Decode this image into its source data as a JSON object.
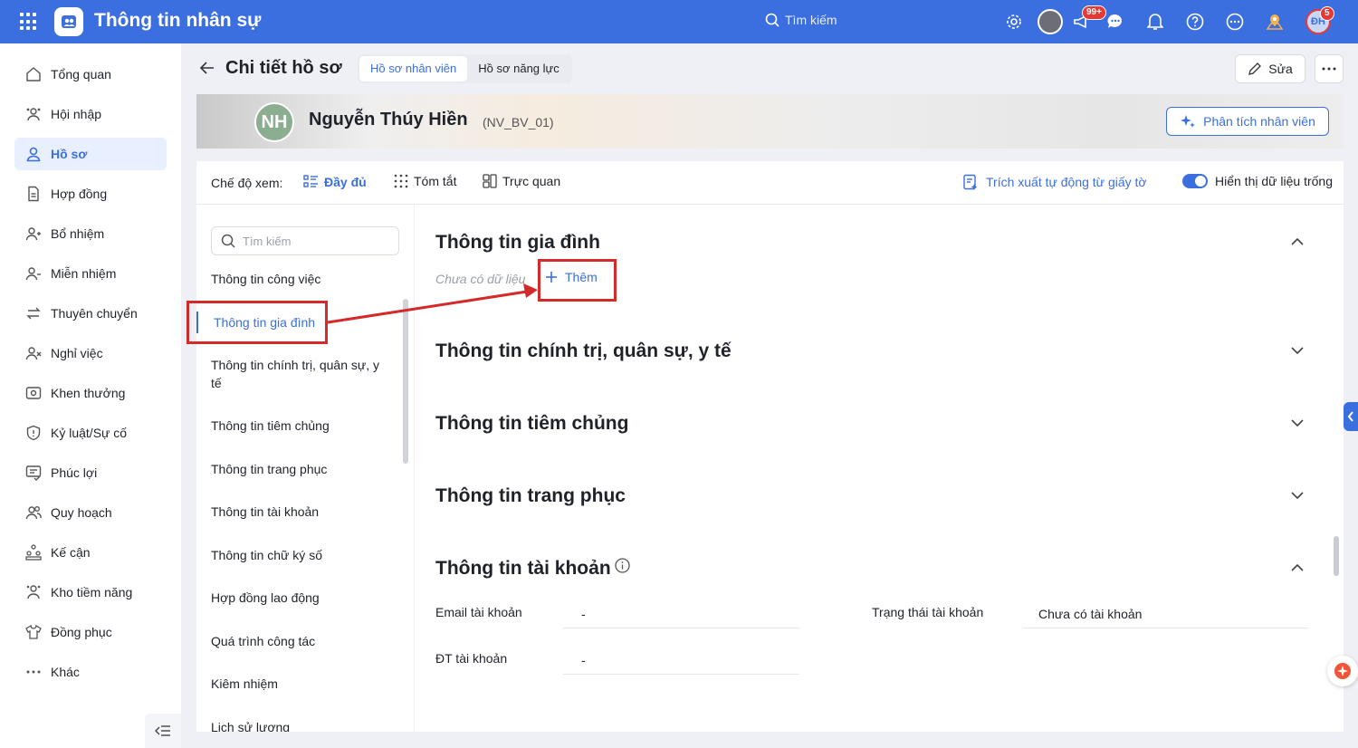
{
  "app": {
    "title": "Thông tin nhân sự",
    "search_placeholder": "Tìm kiếm"
  },
  "topbar": {
    "badges": {
      "notifications": "99+",
      "avatar": "5"
    },
    "user_initials": "ĐH",
    "icons": [
      "gear-icon",
      "avatar",
      "megaphone-icon",
      "chat-icon",
      "bell-icon",
      "help-icon",
      "more-circle-icon",
      "location-icon",
      "user-avatar"
    ]
  },
  "sidebar": {
    "items": [
      {
        "label": "Tổng quan",
        "icon": "home-icon"
      },
      {
        "label": "Hội nhập",
        "icon": "users-icon"
      },
      {
        "label": "Hồ sơ",
        "icon": "user-icon",
        "active": true
      },
      {
        "label": "Hợp đồng",
        "icon": "document-icon"
      },
      {
        "label": "Bổ nhiệm",
        "icon": "user-plus-icon"
      },
      {
        "label": "Miễn nhiệm",
        "icon": "user-minus-icon"
      },
      {
        "label": "Thuyên chuyển",
        "icon": "transfer-icon"
      },
      {
        "label": "Nghỉ việc",
        "icon": "user-x-icon"
      },
      {
        "label": "Khen thưởng",
        "icon": "reward-icon"
      },
      {
        "label": "Kỷ luật/Sự cố",
        "icon": "shield-icon"
      },
      {
        "label": "Phúc lợi",
        "icon": "benefit-icon"
      },
      {
        "label": "Quy hoạch",
        "icon": "group-icon"
      },
      {
        "label": "Kế cận",
        "icon": "org-icon"
      },
      {
        "label": "Kho tiềm năng",
        "icon": "talent-icon"
      },
      {
        "label": "Đồng phục",
        "icon": "shirt-icon"
      },
      {
        "label": "Khác",
        "icon": "dots-icon"
      }
    ]
  },
  "header": {
    "title": "Chi tiết hồ sơ",
    "tabs": [
      {
        "label": "Hồ sơ nhân viên",
        "active": true
      },
      {
        "label": "Hồ sơ năng lực"
      }
    ],
    "edit_label": "Sửa"
  },
  "profile": {
    "initials": "NH",
    "name": "Nguyễn Thúy Hiền",
    "code": "(NV_BV_01)",
    "analyze_label": "Phân tích nhân viên"
  },
  "viewbar": {
    "label": "Chế độ xem:",
    "options": [
      {
        "label": "Đầy đủ",
        "active": true
      },
      {
        "label": "Tóm tắt"
      },
      {
        "label": "Trực quan"
      }
    ],
    "extract_label": "Trích xuất tự động từ giấy tờ",
    "toggle_label": "Hiển thị dữ liệu trống",
    "toggle_on": true
  },
  "leftnav": {
    "search_placeholder": "Tìm kiếm",
    "items": [
      "Thông tin công việc",
      "Thông tin gia đình",
      "Thông tin chính trị, quân sự, y tế",
      "Thông tin tiêm chủng",
      "Thông tin trang phục",
      "Thông tin tài khoản",
      "Thông tin chữ ký số",
      "Hợp đồng lao động",
      "Quá trình công tác",
      "Kiêm nhiệm",
      "Lịch sử lương"
    ],
    "active_index": 1
  },
  "sections": {
    "family": {
      "title": "Thông tin gia đình",
      "empty_text": "Chưa có dữ liệu",
      "add_label": "Thêm"
    },
    "political": {
      "title": "Thông tin chính trị, quân sự, y tế"
    },
    "vaccination": {
      "title": "Thông tin tiêm chủng"
    },
    "uniform": {
      "title": "Thông tin trang phục"
    },
    "account": {
      "title": "Thông tin tài khoản",
      "fields": [
        {
          "label": "Email tài khoản",
          "value": "-"
        },
        {
          "label": "Trạng thái tài khoản",
          "value": "Chưa có tài khoản"
        },
        {
          "label": "ĐT tài khoản",
          "value": "-"
        }
      ]
    }
  },
  "colors": {
    "primary": "#3b6fe0",
    "annotation": "#d42a2a"
  }
}
